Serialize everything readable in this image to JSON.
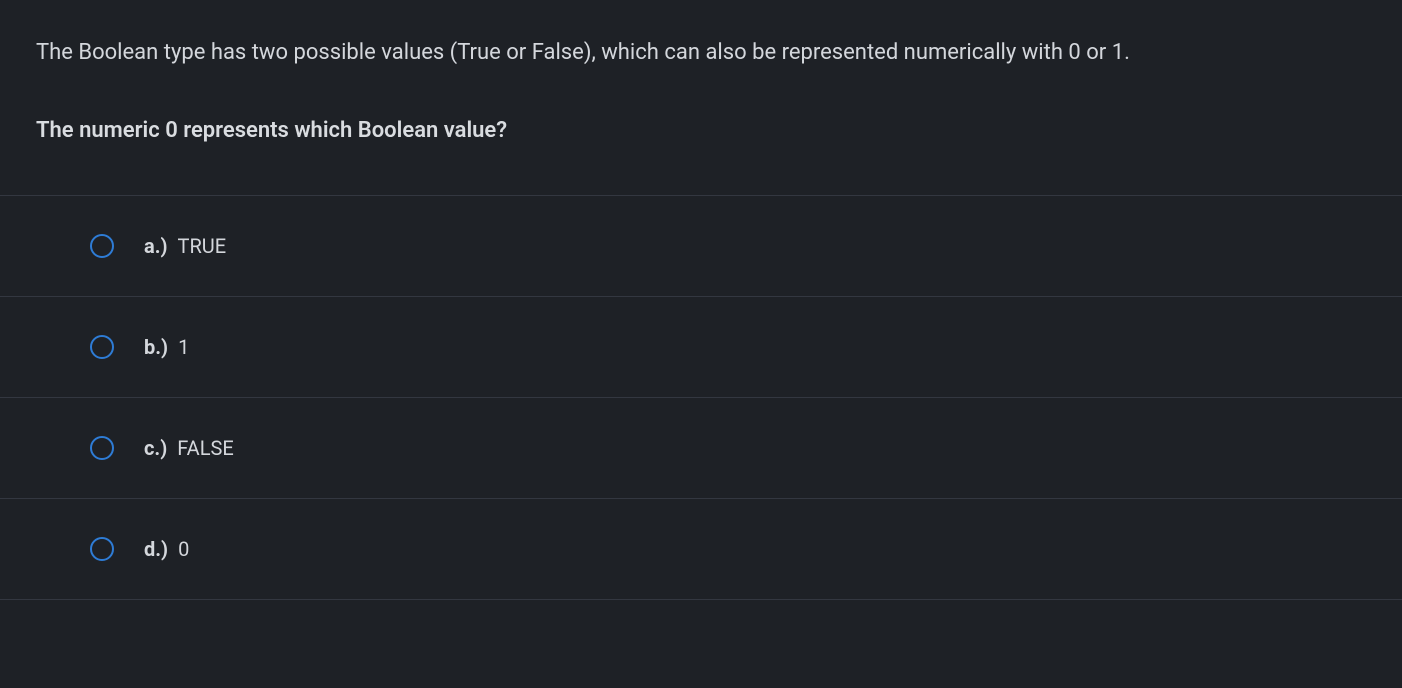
{
  "question": {
    "intro": "The Boolean type has two possible values (True or False), which can also be represented numerically with 0 or 1.",
    "prompt": "The numeric 0 represents which Boolean value?"
  },
  "options": [
    {
      "letter": "a.)",
      "text": "TRUE"
    },
    {
      "letter": "b.)",
      "text": "1"
    },
    {
      "letter": "c.)",
      "text": "FALSE"
    },
    {
      "letter": "d.)",
      "text": "0"
    }
  ]
}
